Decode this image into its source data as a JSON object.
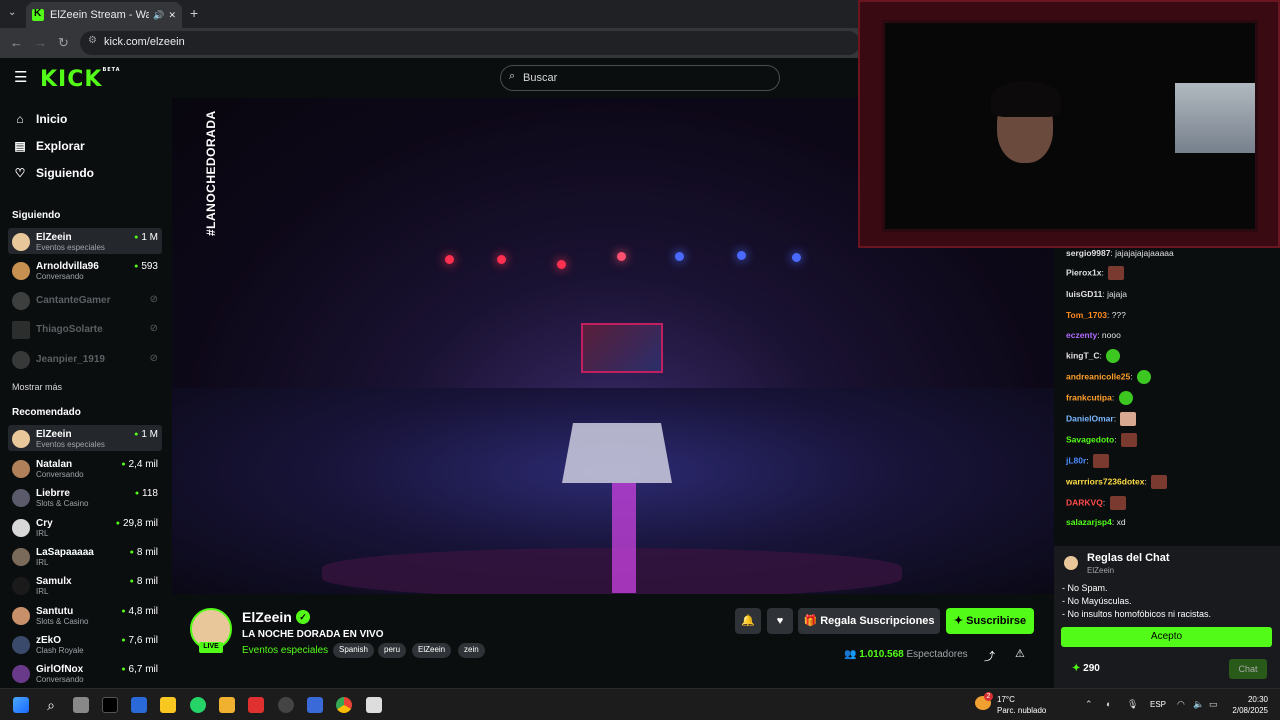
{
  "browser": {
    "tab_title": "ElZeein Stream - Watch Live",
    "url": "kick.com/elzeein",
    "new_tab": "+",
    "close_tab": "✕"
  },
  "header": {
    "logo": "KICK",
    "logo_badge": "BETA",
    "search_placeholder": "Buscar"
  },
  "sidebar": {
    "nav": [
      {
        "label": "Inicio",
        "icon": "home-icon"
      },
      {
        "label": "Explorar",
        "icon": "compass-icon"
      },
      {
        "label": "Siguiendo",
        "icon": "heart-icon"
      }
    ],
    "following_title": "Siguiendo",
    "following": [
      {
        "name": "ElZeein",
        "category": "Eventos especiales",
        "viewers": "1 M",
        "live": true
      },
      {
        "name": "Arnoldvilla96",
        "category": "Conversando",
        "viewers": "593",
        "live": true
      },
      {
        "name": "CantanteGamer",
        "category": "",
        "viewers": "",
        "live": false
      },
      {
        "name": "ThiagoSolarte",
        "category": "",
        "viewers": "",
        "live": false
      },
      {
        "name": "Jeanpier_1919",
        "category": "",
        "viewers": "",
        "live": false
      }
    ],
    "show_more": "Mostrar más",
    "recommended_title": "Recomendado",
    "recommended": [
      {
        "name": "ElZeein",
        "category": "Eventos especiales",
        "viewers": "1 M"
      },
      {
        "name": "Natalan",
        "category": "Conversando",
        "viewers": "2,4 mil"
      },
      {
        "name": "Liebrre",
        "category": "Slots & Casino",
        "viewers": "118"
      },
      {
        "name": "Cry",
        "category": "IRL",
        "viewers": "29,8 mil"
      },
      {
        "name": "LaSapaaaaa",
        "category": "IRL",
        "viewers": "8 mil"
      },
      {
        "name": "Samulx",
        "category": "IRL",
        "viewers": "8 mil"
      },
      {
        "name": "Santutu",
        "category": "Slots & Casino",
        "viewers": "4,8 mil"
      },
      {
        "name": "zEkO",
        "category": "Clash Royale",
        "viewers": "7,6 mil"
      },
      {
        "name": "GirlOfNox",
        "category": "Conversando",
        "viewers": "6,7 mil"
      }
    ]
  },
  "video": {
    "overlay_tag": "#LANOCHEDORADA"
  },
  "stream": {
    "channel": "ElZeein",
    "live_badge": "LIVE",
    "title": "LA NOCHE DORADA EN VIVO",
    "category": "Eventos especiales",
    "tags": [
      "Spanish",
      "peru",
      "ElZeein",
      "zein"
    ],
    "gift_label": "Regala Suscripciones",
    "subscribe_label": "Suscribirse",
    "viewer_count": "1.010.568",
    "viewer_label": "Espectadores"
  },
  "chat": {
    "messages": [
      {
        "user": "sergio9987",
        "color": "#ffffff",
        "text": "jajajajajajaaaaa",
        "emote": ""
      },
      {
        "user": "Pierox1x",
        "color": "#ffffff",
        "text": "",
        "emote": "brown"
      },
      {
        "user": "luisGD11",
        "color": "#ffffff",
        "text": "jajaja",
        "emote": ""
      },
      {
        "user": "Tom_1703",
        "color": "#ff8a1e",
        "text": "???",
        "emote": ""
      },
      {
        "user": "eczenty",
        "color": "#b06aff",
        "text": "nooo",
        "emote": ""
      },
      {
        "user": "kingT_C",
        "color": "#ffffff",
        "text": "",
        "emote": "green"
      },
      {
        "user": "andreanicolle25",
        "color": "#ff9f2a",
        "text": "",
        "emote": "green"
      },
      {
        "user": "frankcutipa",
        "color": "#ff9f2a",
        "text": "",
        "emote": "green"
      },
      {
        "user": "DanielOmar",
        "color": "#7ab8ff",
        "text": "",
        "emote": "brown"
      },
      {
        "user": "Savagedoto",
        "color": "#53fc18",
        "text": "",
        "emote": "brown"
      },
      {
        "user": "jL80r",
        "color": "#4a8aff",
        "text": "",
        "emote": "brown"
      },
      {
        "user": "warrriors7236dotex",
        "color": "#ffdd44",
        "text": "",
        "emote": "brown"
      },
      {
        "user": "DARKVQ",
        "color": "#ff4a4a",
        "text": "",
        "emote": "brown"
      },
      {
        "user": "salazarjsp4",
        "color": "#53fc18",
        "text": "xd",
        "emote": ""
      }
    ],
    "rules_title": "Reglas del Chat",
    "rules_channel": "ElZeein",
    "rules": [
      "- No Spam.",
      "- No Mayúsculas.",
      "- No insultos homofóbicos ni racistas."
    ],
    "accept_label": "Acepto",
    "points": "290",
    "chat_button": "Chat"
  },
  "taskbar": {
    "temperature": "17°C",
    "weather": "Parc. nublado",
    "weather_badge": "2",
    "language": "ESP",
    "time": "20:30",
    "date": "2/08/2025"
  },
  "colors": {
    "accent": "#53fc18",
    "bg": "#0b0e0f",
    "panel": "#181a1d"
  }
}
